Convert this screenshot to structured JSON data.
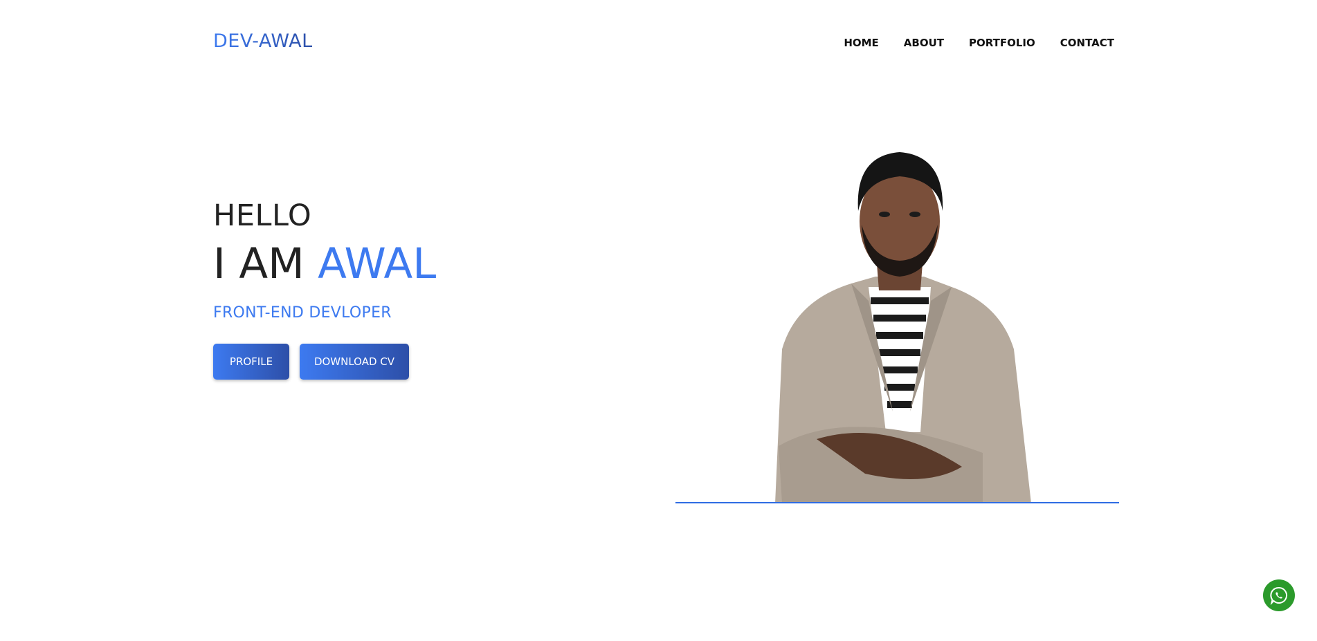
{
  "header": {
    "logo": "DEV-AWAL",
    "nav": [
      "HOME",
      "ABOUT",
      "PORTFOLIO",
      "CONTACT"
    ]
  },
  "hero": {
    "greeting": "HELLO",
    "intro_prefix": "I AM",
    "name": "AWAL",
    "role": "FRONT-END DEVLOPER",
    "buttons": {
      "profile": "PROFILE",
      "download_cv": "DOWNLOAD CV"
    }
  },
  "icons": {
    "whatsapp": "whatsapp-icon"
  },
  "colors": {
    "accent": "#3d7af0",
    "accent_dark": "#2d4fa8",
    "whatsapp": "#2b9a2b"
  }
}
